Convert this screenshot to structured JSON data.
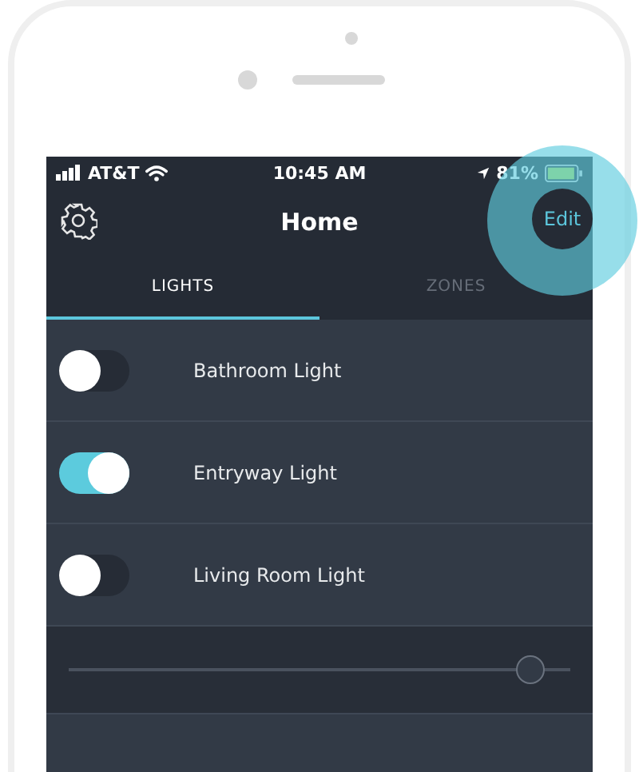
{
  "status_bar": {
    "carrier": "AT&T",
    "time": "10:45 AM",
    "battery": "81%"
  },
  "header": {
    "title": "Home",
    "action": "Edit"
  },
  "tabs": [
    {
      "label": "LIGHTS",
      "selected": true
    },
    {
      "label": "ZONES",
      "selected": false
    }
  ],
  "lights": [
    {
      "name": "Bathroom Light",
      "on": false
    },
    {
      "name": "Entryway Light",
      "on": true
    },
    {
      "name": "Living Room Light",
      "on": false
    }
  ],
  "slider": {
    "level": 0.92
  }
}
